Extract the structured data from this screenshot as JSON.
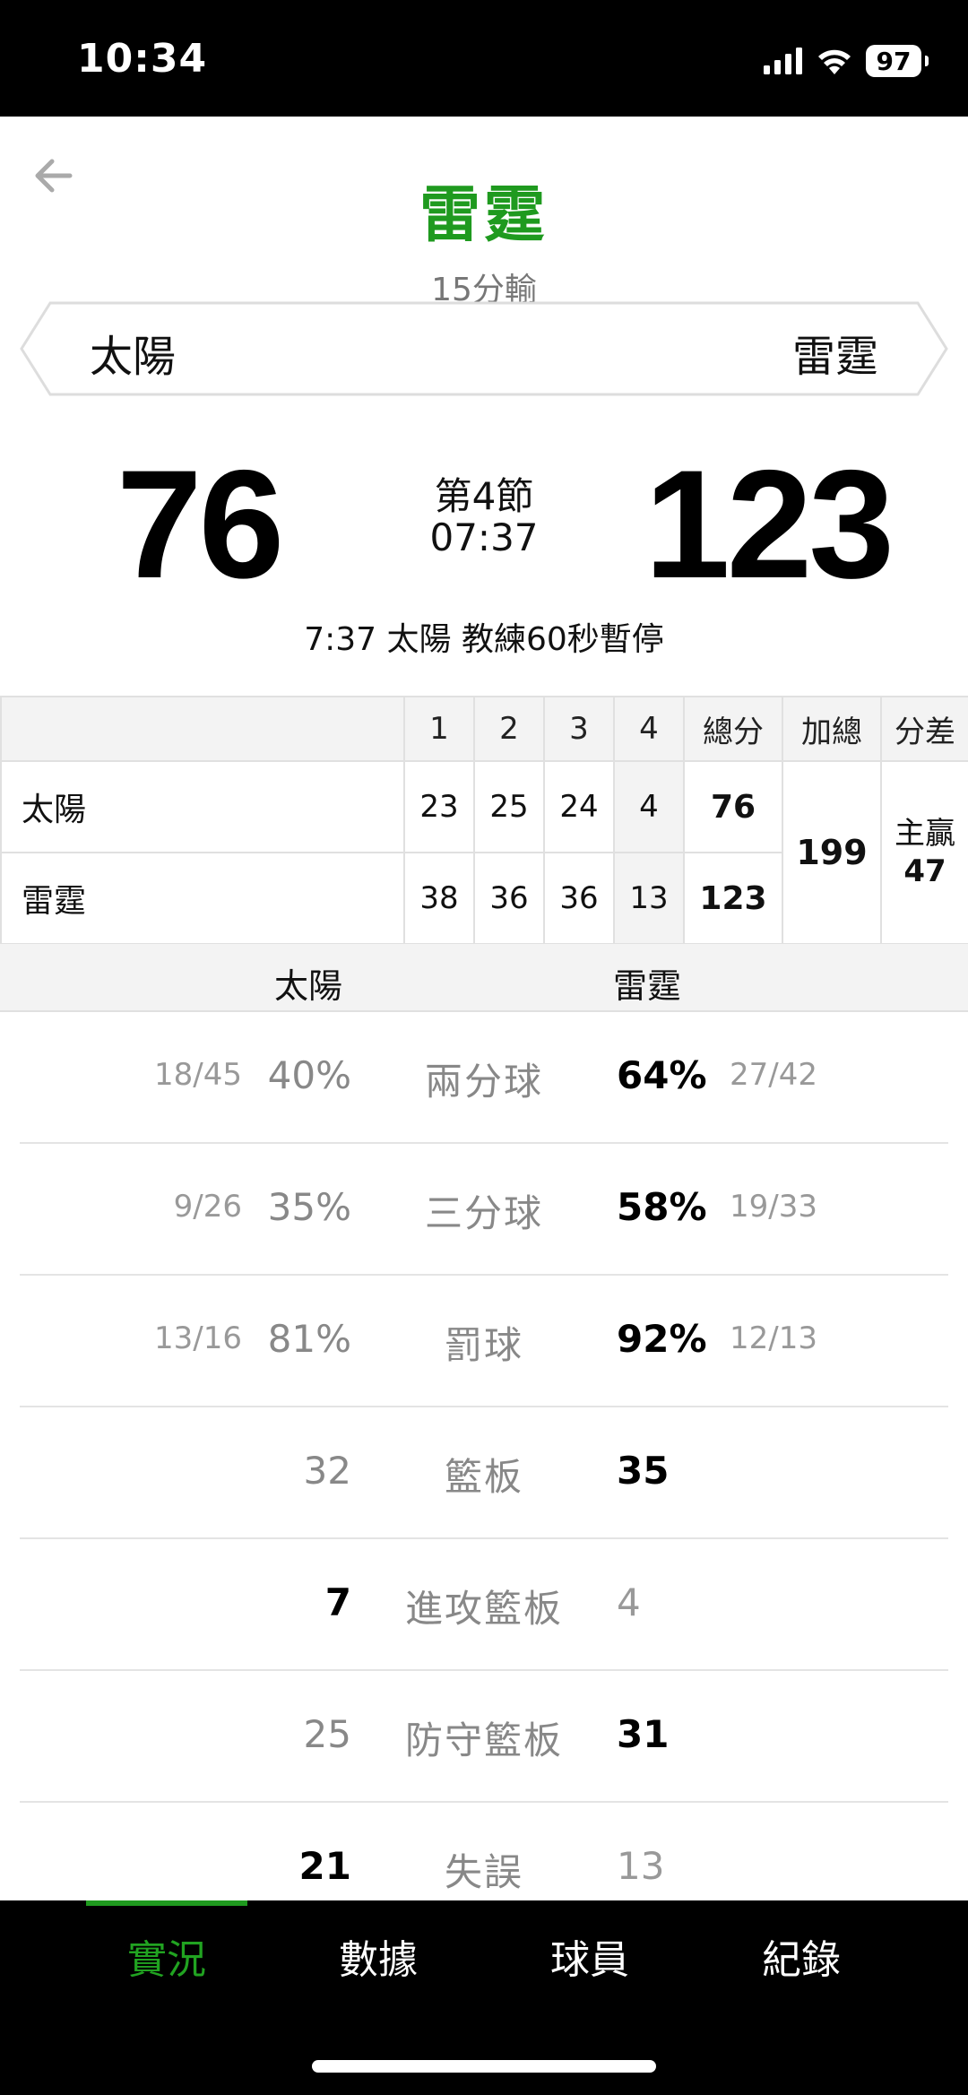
{
  "status_bar": {
    "time": "10:34",
    "battery": "97"
  },
  "header": {
    "title": "雷霆",
    "subtitle": "15分輸"
  },
  "teams": {
    "left": "太陽",
    "right": "雷霆"
  },
  "scoreboard": {
    "left_score": "76",
    "right_score": "123",
    "period": "第4節",
    "clock": "07:37",
    "play_by_play": "7:37 太陽  教練60秒暫停"
  },
  "box_score": {
    "headers": [
      "",
      "1",
      "2",
      "3",
      "4",
      "總分",
      "加總",
      "分差"
    ],
    "rows": [
      {
        "team": "太陽",
        "q": [
          "23",
          "25",
          "24",
          "4"
        ],
        "total": "76"
      },
      {
        "team": "雷霆",
        "q": [
          "38",
          "36",
          "36",
          "13"
        ],
        "total": "123"
      }
    ],
    "combined": "199",
    "diff_label": "主贏",
    "diff_value": "47"
  },
  "stats_header": {
    "left": "太陽",
    "right": "雷霆"
  },
  "stats": [
    {
      "label": "兩分球",
      "left_frac": "18/45",
      "left": "40%",
      "right": "64%",
      "right_frac": "27/42"
    },
    {
      "label": "三分球",
      "left_frac": "9/26",
      "left": "35%",
      "right": "58%",
      "right_frac": "19/33"
    },
    {
      "label": "罰球",
      "left_frac": "13/16",
      "left": "81%",
      "right": "92%",
      "right_frac": "12/13"
    },
    {
      "label": "籃板",
      "left_frac": "",
      "left": "32",
      "right": "35",
      "right_frac": ""
    },
    {
      "label": "進攻籃板",
      "left_frac": "",
      "left": "7",
      "right": "4",
      "right_frac": ""
    },
    {
      "label": "防守籃板",
      "left_frac": "",
      "left": "25",
      "right": "31",
      "right_frac": ""
    },
    {
      "label": "失誤",
      "left_frac": "",
      "left": "21",
      "right": "13",
      "right_frac": ""
    }
  ],
  "tabs": [
    "實況",
    "數據",
    "球員",
    "紀錄"
  ],
  "colors": {
    "accent": "#1f9a1f",
    "background": "#ffffff",
    "tabbar": "#000000"
  }
}
